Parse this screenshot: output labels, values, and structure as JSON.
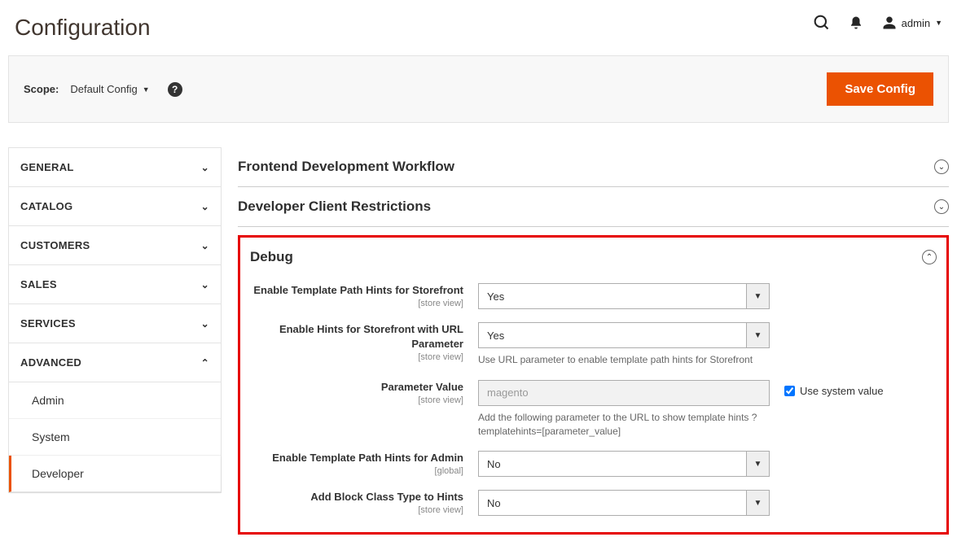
{
  "page": {
    "title": "Configuration"
  },
  "topbar": {
    "admin_label": "admin"
  },
  "scope": {
    "label": "Scope:",
    "value": "Default Config",
    "save_label": "Save Config"
  },
  "sidebar": {
    "general": "GENERAL",
    "catalog": "CATALOG",
    "customers": "CUSTOMERS",
    "sales": "SALES",
    "services": "SERVICES",
    "advanced": "ADVANCED",
    "advanced_items": {
      "admin": "Admin",
      "system": "System",
      "developer": "Developer"
    }
  },
  "sections": {
    "frontend": "Frontend Development Workflow",
    "restrictions": "Developer Client Restrictions",
    "debug": "Debug"
  },
  "debug": {
    "f1": {
      "label": "Enable Template Path Hints for Storefront",
      "scope": "[store view]",
      "value": "Yes"
    },
    "f2": {
      "label": "Enable Hints for Storefront with URL Parameter",
      "scope": "[store view]",
      "value": "Yes",
      "note": "Use URL parameter to enable template path hints for Storefront"
    },
    "f3": {
      "label": "Parameter Value",
      "scope": "[store view]",
      "value": "magento",
      "note": "Add the following parameter to the URL to show template hints ?templatehints=[parameter_value]",
      "checkbox_label": "Use system value"
    },
    "f4": {
      "label": "Enable Template Path Hints for Admin",
      "scope": "[global]",
      "value": "No"
    },
    "f5": {
      "label": "Add Block Class Type to Hints",
      "scope": "[store view]",
      "value": "No"
    }
  }
}
